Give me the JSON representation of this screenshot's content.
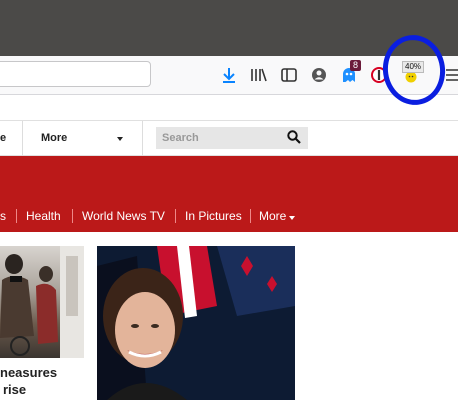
{
  "toolbar": {
    "badge_count": "8",
    "zoom_badge": "40%"
  },
  "navbar": {
    "left_fragment": "e",
    "more_label": "More",
    "search_placeholder": "Search"
  },
  "menu": {
    "items": [
      {
        "label": "s"
      },
      {
        "label": "Health"
      },
      {
        "label": "World News TV"
      },
      {
        "label": "In Pictures"
      },
      {
        "label": "More"
      }
    ]
  },
  "articles": {
    "headline_line1": "neasures",
    "headline_line2": "rise"
  },
  "colors": {
    "brand_red": "#bb1919",
    "annotation_circle": "#0a1ee0"
  }
}
